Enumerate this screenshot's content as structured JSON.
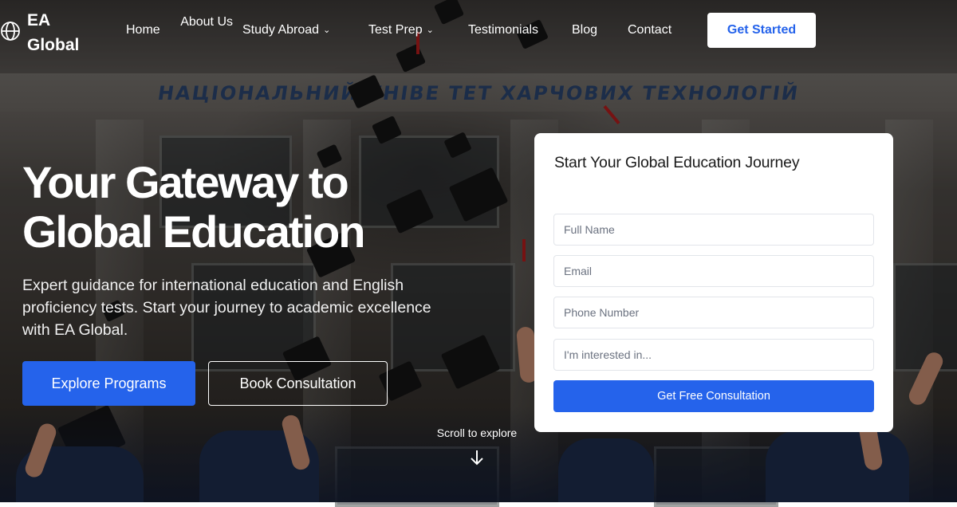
{
  "brand": {
    "name": "EA Global",
    "accent": "#2563eb"
  },
  "nav": {
    "items": [
      {
        "label": "Home"
      },
      {
        "label": "About Us"
      },
      {
        "label": "Study Abroad",
        "has_dropdown": true
      },
      {
        "label": "Test Prep",
        "has_dropdown": true
      },
      {
        "label": "Testimonials"
      },
      {
        "label": "Blog"
      },
      {
        "label": "Contact"
      }
    ],
    "cta_label": "Get Started"
  },
  "hero": {
    "title": "Your Gateway to Global Education",
    "subtitle": "Expert guidance for international education and English proficiency tests. Start your journey to academic excellence with EA Global.",
    "primary_button": "Explore Programs",
    "secondary_button": "Book Consultation",
    "scroll_hint": "Scroll to explore",
    "background_lettering": "НАЦІОНАЛЬНИЙ УНІВЕ ТЕТ ХАРЧОВИХ ТЕХНОЛОГІЙ"
  },
  "form": {
    "title": "Start Your Global Education Journey",
    "fields": [
      {
        "placeholder": "Full Name",
        "value": ""
      },
      {
        "placeholder": "Email",
        "value": ""
      },
      {
        "placeholder": "Phone Number",
        "value": ""
      },
      {
        "placeholder": "I'm interested in...",
        "value": ""
      }
    ],
    "submit_label": "Get Free Consultation"
  },
  "icons": {
    "logo": "globe-icon",
    "dropdown": "chevron-down-icon",
    "scroll": "arrow-down-icon"
  }
}
